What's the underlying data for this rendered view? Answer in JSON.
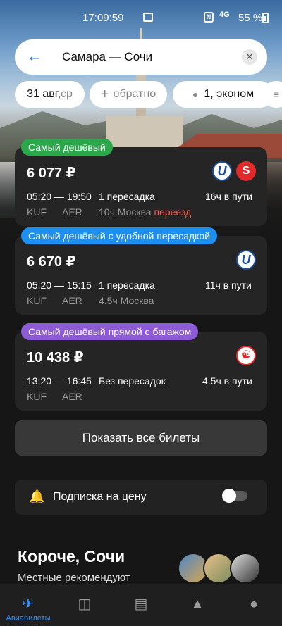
{
  "status": {
    "time": "17:09:59",
    "network": "4G",
    "battery": "55 %"
  },
  "search": {
    "route": "Самара — Сочи"
  },
  "chips": {
    "date": "31 авг,",
    "weekday": " ср",
    "return": "обратно",
    "passengers": "1, эконом"
  },
  "offers": [
    {
      "badge": "Самый дешёвый",
      "badge_color": "#2aa84a",
      "price": "6 077 ₽",
      "times": "05:20 — 19:50",
      "stops": "1 пересадка",
      "duration": "16ч в пути",
      "from": "KUF",
      "to": "AER",
      "stop_info": "10ч Москва",
      "stop_warning": "переезд",
      "airlines": [
        "utair-logo",
        "s7-logo"
      ]
    },
    {
      "badge": "Самый дешёвый с удобной пересадкой",
      "badge_color": "#1d8ff0",
      "price": "6 670 ₽",
      "times": "05:20 — 15:15",
      "stops": "1 пересадка",
      "duration": "11ч в пути",
      "from": "KUF",
      "to": "AER",
      "stop_info": "4.5ч Москва",
      "airlines": [
        "utair-logo"
      ]
    },
    {
      "badge": "Самый дешёвый прямой с багажом",
      "badge_color": "#8d5bd6",
      "price": "10 438 ₽",
      "times": "13:20 — 16:45",
      "stops": "Без пересадок",
      "duration": "4.5ч в пути",
      "from": "KUF",
      "to": "AER",
      "airlines": [
        "smartavia-logo"
      ]
    }
  ],
  "show_all": "Показать все билеты",
  "subscription": {
    "label": "Подписка на цену",
    "enabled": false
  },
  "promo": {
    "title": "Короче, Сочи",
    "subtitle": "Местные рекомендуют"
  },
  "tabs": [
    {
      "label": "Авиабилеты",
      "icon": "plane-icon",
      "active": true
    },
    {
      "label": "",
      "icon": "bed-icon",
      "active": false
    },
    {
      "label": "",
      "icon": "journal-icon",
      "active": false
    },
    {
      "label": "",
      "icon": "bell-icon",
      "active": false
    },
    {
      "label": "",
      "icon": "profile-icon",
      "active": false
    }
  ]
}
